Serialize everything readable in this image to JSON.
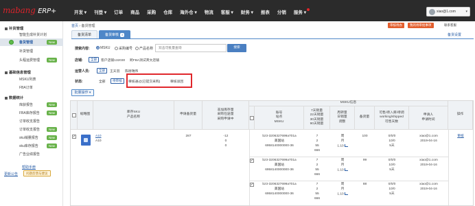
{
  "header": {
    "logo_main": "mabang",
    "logo_sub": "ERP+",
    "nav": [
      "开发 ▾",
      "刊登 ▾",
      "订单",
      "商品",
      "采购",
      "仓库",
      "海外仓 ▾",
      "物流",
      "客服 ▾",
      "财务 ▾",
      "报表",
      "分销",
      "服务 ▾"
    ],
    "user": "xiao@1.com",
    "user_caret": "▾"
  },
  "sidebar": {
    "sections": [
      {
        "title": "补货管理"
      },
      {
        "title": "基础信息管理"
      },
      {
        "title": "数据统计"
      }
    ],
    "items": [
      {
        "label": "智能生成补货计划",
        "badge": ""
      },
      {
        "label": "备货管理",
        "badge": "New"
      },
      {
        "label": "补货管理",
        "badge": ""
      },
      {
        "label": "头程运费管理",
        "badge": "New"
      },
      {
        "label": "MSKU列表",
        "badge": ""
      },
      {
        "label": "FBA订单",
        "badge": ""
      },
      {
        "label": "库龄报告",
        "badge": "New"
      },
      {
        "label": "FBA库存报告",
        "badge": "New"
      },
      {
        "label": "订单收支报告",
        "badge": ""
      },
      {
        "label": "订单收支报告",
        "badge": "New"
      },
      {
        "label": "sku销量报告",
        "badge": "New"
      },
      {
        "label": "sku库存报告",
        "badge": "New"
      },
      {
        "label": "广告业绩报告",
        "badge": ""
      }
    ],
    "help_link": "帮助手册",
    "footer_link": "更新公告",
    "footer_btn": "问题反馈与建议"
  },
  "breadcrumb": {
    "home": "首页",
    "sep": " › ",
    "current": "备货管理"
  },
  "top_buttons": {
    "b1": "审核待办",
    "b2": "我的待审批事项",
    "help": "联系客服"
  },
  "tabs": [
    {
      "label": "备货清单",
      "badge": ""
    },
    {
      "label": "备货审核",
      "badge": "3"
    }
  ],
  "settings_link": "备货设置",
  "filter": {
    "search_label": "搜索内容:",
    "radios": [
      "MSKU",
      "采购编号",
      "产品名称"
    ],
    "search_placeholder": "双击可批量查询",
    "search_btn": "搜索",
    "shop_label": "店铺:",
    "shop_all": "全部",
    "shop_opts": [
      "客户店铺132030",
      "跨FBA测试英文店铺"
    ],
    "person_label": "运营人员:",
    "person_all": "全部",
    "person_opts": [
      "王天羽",
      "陈德瑞伟"
    ],
    "status_label": "状态:",
    "status_all": "全部",
    "status_active": "待审核",
    "status_opts": [
      "审核通过(已提交采购)",
      "审核驳回"
    ],
    "batch_btn": "批量操作 ▾"
  },
  "table": {
    "headers": {
      "img": "缩略图",
      "sku": "库存SKU\n产品名称",
      "apply_qty": "申请备货量",
      "unsigned": "非加库存量\n采购在途量\n采购申请中",
      "msku_group": "MSKU信息",
      "acct": "账号\n站点\nMSKU",
      "sales": "7天销量\n22天销量\n30天销量\n90天销量",
      "weekly": "周转量\n日销量\n调整",
      "stock_qty": "备货量",
      "avail": "可售/待入库/待调\nworking/shipped\n可售天数",
      "applicant": "申请人\n申请时间",
      "op": "操作"
    },
    "row": {
      "sku_link": "A10",
      "sku_name": "A10",
      "apply_qty": "287",
      "unsigned": [
        "-12",
        "0",
        "0"
      ],
      "applicant": "xiao@1.com",
      "time": "2019-04-16",
      "op": "审核"
    },
    "subrows": [
      {
        "acct": "bz3-3206327699a701a",
        "site": "美国站",
        "msku": "6958140000000-36",
        "sales": [
          "7",
          "2",
          "55",
          "666"
        ],
        "weekly": [
          "周",
          "月",
          "1.10"
        ],
        "qty": "100",
        "avail": [
          "0/0/0",
          "10/0",
          "5天"
        ],
        "applicant": "xiao@1.com",
        "time": "2019-04-16",
        "op": "撤销"
      },
      {
        "acct": "bz3-3206327699a701a",
        "site": "美国站",
        "msku": "6958140000000-36",
        "sales": [
          "7",
          "2",
          "55",
          "666"
        ],
        "weekly": [
          "周",
          "月",
          "1.10"
        ],
        "qty": "99",
        "avail": [
          "0/0/0",
          "10/0",
          "5天"
        ],
        "applicant": "xiao@1.com",
        "time": "2019-04-16",
        "op": ""
      },
      {
        "acct": "bz3-3206327699a701a",
        "site": "美国站",
        "msku": "6958140000000-36",
        "sales": [
          "7",
          "2",
          "55",
          "666"
        ],
        "weekly": [
          "周",
          "月",
          "1.10"
        ],
        "qty": "88",
        "avail": [
          "0/0/0",
          "10/0",
          "5天"
        ],
        "applicant": "xiao@1.com",
        "time": "2019-04-16",
        "op": ""
      }
    ]
  },
  "colors": {
    "brand_red": "#d9232b",
    "accent_blue": "#4e87c8",
    "highlight_red": "#e0262b",
    "new_green": "#68b24a"
  }
}
